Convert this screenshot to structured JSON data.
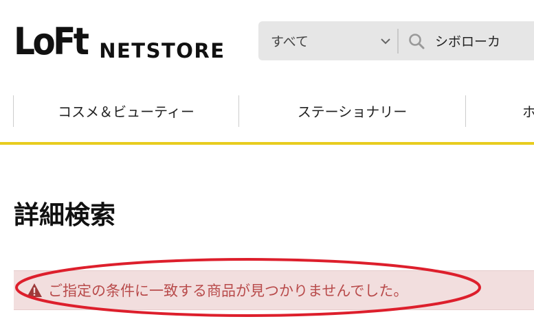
{
  "header": {
    "logo_mark": "LoFt",
    "logo_sub": "NETSTORE",
    "search": {
      "category_label": "すべて",
      "query": "シボローカ",
      "category_icon": "chevron-down-icon",
      "search_icon": "search-icon"
    }
  },
  "nav": {
    "items": [
      {
        "label": "コスメ＆ビューティー"
      },
      {
        "label": "ステーショナリー"
      },
      {
        "label": "ホ"
      }
    ]
  },
  "main": {
    "title": "詳細検索",
    "alert": {
      "icon": "warning-icon",
      "message": "ご指定の条件に一致する商品が見つかりませんでした。"
    }
  },
  "colors": {
    "accent_yellow": "#e8cc1e",
    "alert_bg": "#f2dede",
    "alert_text": "#b84a4a",
    "annotation_red": "#dd1f2c",
    "search_bg": "#e6e6e6"
  }
}
